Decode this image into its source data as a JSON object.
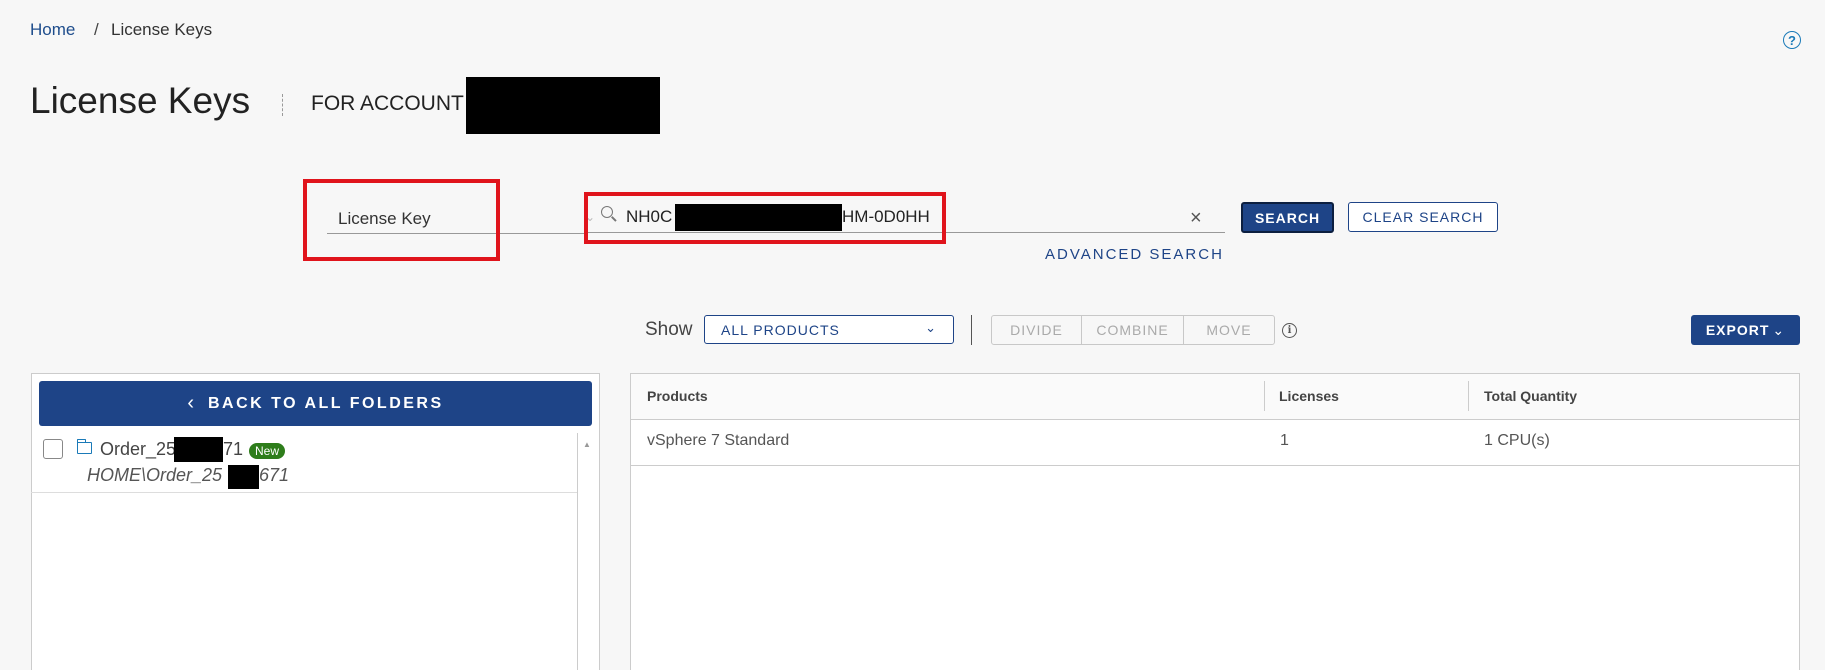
{
  "breadcrumb": {
    "home": "Home",
    "separator": "/",
    "current": "License Keys"
  },
  "help_icon": "?",
  "page": {
    "title": "License Keys",
    "account_label": "FOR ACCOUNT"
  },
  "search": {
    "field_selected": "License Key",
    "value_prefix": "NH0C",
    "value_suffix": "HM-0D0HH",
    "search_button": "SEARCH",
    "clear_button": "CLEAR SEARCH",
    "advanced_search": "ADVANCED SEARCH"
  },
  "toolbar": {
    "show_label": "Show",
    "products_filter": "ALL PRODUCTS",
    "actions": [
      "DIVIDE",
      "COMBINE",
      "MOVE"
    ],
    "info_icon": "i",
    "export_button": "EXPORT"
  },
  "folders": {
    "back_button": "BACK TO ALL FOLDERS",
    "items": [
      {
        "name_prefix": "Order_25",
        "name_suffix": "71",
        "badge": "New",
        "path_prefix": "HOME\\Order_25",
        "path_suffix": "671"
      }
    ]
  },
  "table": {
    "columns": [
      "Products",
      "Licenses",
      "Total Quantity"
    ],
    "rows": [
      {
        "product": "vSphere 7 Standard",
        "licenses": "1",
        "quantity": "1 CPU(s)"
      }
    ]
  },
  "colors": {
    "accent": "#1e4487",
    "highlight": "#e0141c",
    "badge": "#2e7d1b"
  }
}
